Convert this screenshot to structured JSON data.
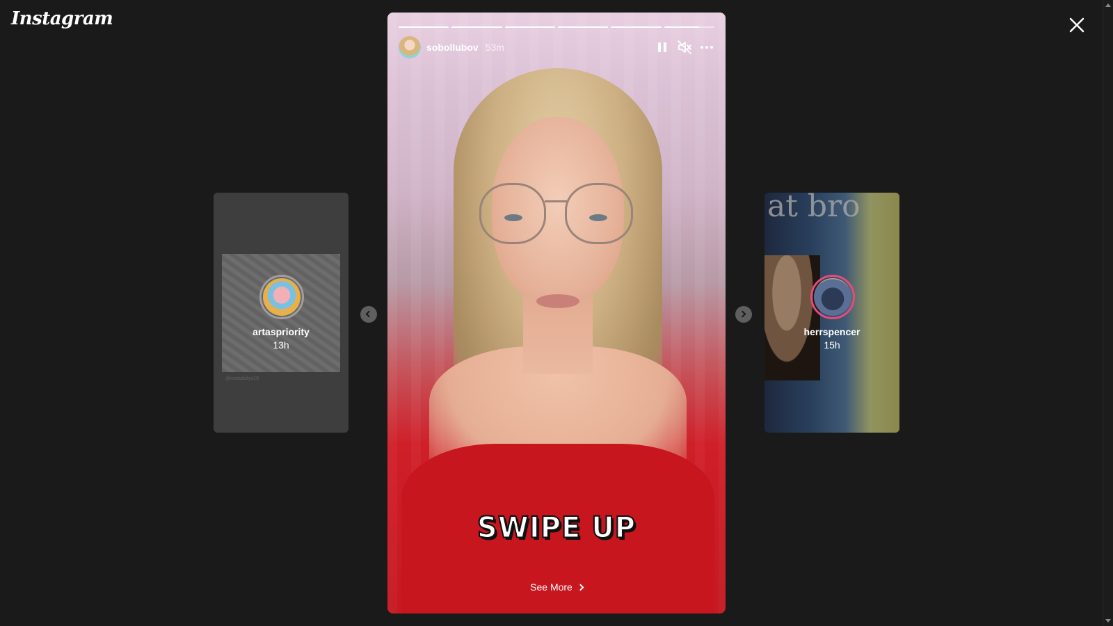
{
  "app": {
    "logo_text": "Instagram"
  },
  "story": {
    "username": "sobollubov",
    "time": "53m",
    "progress": [
      1,
      1,
      1,
      1,
      1,
      0.7
    ],
    "overlay_text": "SWIPE UP",
    "see_more_label": "See More",
    "icons": [
      "pause-icon",
      "muted-icon",
      "more-options-icon"
    ]
  },
  "prev_story": {
    "username": "artaspriority",
    "time": "13h",
    "watermark": "@instadailyo18"
  },
  "next_story": {
    "username": "herrspencer",
    "time": "15h",
    "wall_text": "at bro"
  },
  "nav": {
    "prev_icon": "chevron-left-icon",
    "next_icon": "chevron-right-icon",
    "close_icon": "close-icon"
  }
}
